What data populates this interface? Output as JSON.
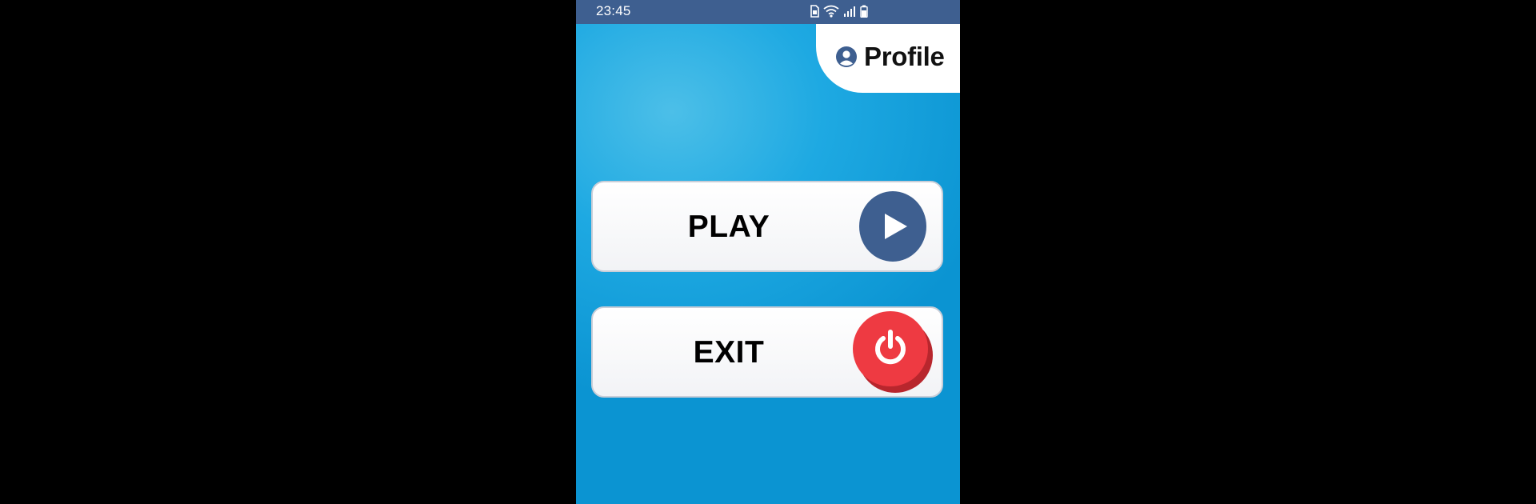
{
  "status_bar": {
    "time": "23:45",
    "icons": [
      "sim-icon",
      "wifi-icon",
      "signal-icon",
      "battery-icon"
    ]
  },
  "profile": {
    "label": "Profile",
    "icon": "user-circle-icon"
  },
  "menu": {
    "play": {
      "label": "PLAY",
      "icon": "play-icon"
    },
    "exit": {
      "label": "EXIT",
      "icon": "power-icon"
    }
  },
  "colors": {
    "status_bar": "#3e5f90",
    "background": "#1ea9e2",
    "play_accent": "#3e5f90",
    "exit_accent": "#ee3a42",
    "button_face": "#ffffff"
  }
}
